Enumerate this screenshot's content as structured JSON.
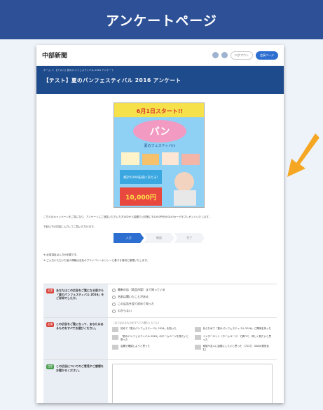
{
  "banner": {
    "title": "アンケートページ"
  },
  "site": {
    "logo": "中部新聞",
    "header_buttons": [
      "ログアウト",
      "会員ページ"
    ]
  },
  "hero": {
    "breadcrumb": "ホーム ＞ 【テスト】夏のパンフェスティバル 2016 アンケート",
    "title": "【テスト】夏のパンフェスティバル 2016 アンケート"
  },
  "poster": {
    "headline": "6月1日スタート!!",
    "logo_text": "パン",
    "sub": "夏のフェスティバル",
    "prize": "総計1000名様にあたる!",
    "prize_big": "10,000円"
  },
  "intro": {
    "p1": "こちらのキャンペーンをご覧になり、アンケートにご回答いただいた方の中から抽選で公式帳にも1000円分のQUOカードをプレゼントいたします。",
    "p2": "下記以下の内容に入力してご覧いただけます。"
  },
  "steps": [
    "入力",
    "確認",
    "完了"
  ],
  "notes": {
    "n1": "※ 必須項目は入力が必要です。",
    "n2": "※ ご入力いただいた個人情報は当社のプライバシーポリシーに基づき適切に管理いたします。"
  },
  "questions": [
    {
      "badge": "必須",
      "text": "あなたはこの広告をご覧になる前から「夏のパンフェスティバル 2016」をご存知でしたか。",
      "options": [
        "最新の店（商品内容）まで知っている",
        "名前は聞いたことがある",
        "この広告を見て初めて知った",
        "わからない"
      ]
    },
    {
      "badge": "必須",
      "text": "この広告をご覧になって、あなたはあるものをすべてお選びください。",
      "hint": "（当てはまるものをすべてお選びください）",
      "options": [
        "初めて「夏のパンフェスティバル 2016」を知った",
        "あらためて「夏のパンフェスティバル 2016」に興味を持った",
        "「夏のパンフェスティバル 2016」のホームページを見たいと思った",
        "インターネット（ホームページ）で調べて、詳しく見たいと思った",
        "店舗で確認しようと思った",
        "家族や友人に話題にしたいと思った（ブログ、SNSの発信含む）"
      ]
    },
    {
      "badge": "任意",
      "text": "この広告についてのご意見やご感想をお聞かせください。"
    }
  ],
  "colors": {
    "banner": "#2d5096",
    "hero": "#1e4b8c",
    "accent": "#2d6fd0",
    "arrow": "#f5a623"
  }
}
